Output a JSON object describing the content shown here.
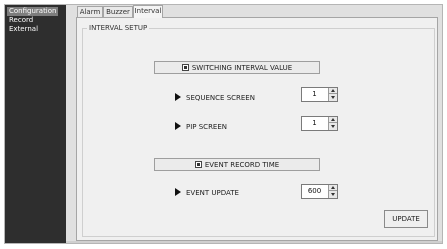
{
  "sidebar": {
    "items": [
      {
        "label": "Configuration",
        "selected": true
      },
      {
        "label": "Record",
        "selected": false
      },
      {
        "label": "External",
        "selected": false
      }
    ]
  },
  "tabs": [
    {
      "label": "Alarm",
      "active": false
    },
    {
      "label": "Buzzer",
      "active": false
    },
    {
      "label": "Interval",
      "active": true
    }
  ],
  "panel": {
    "legend": "INTERVAL SETUP",
    "switching": {
      "header": "SWITCHING INTERVAL VALUE",
      "sequence_label": "SEQUENCE  SCREEN",
      "sequence_value": "1",
      "pip_label": "PIP   SCREEN",
      "pip_value": "1"
    },
    "event": {
      "header": "EVENT RECORD TIME",
      "update_label": "EVENT UPDATE",
      "update_value": "600"
    },
    "update_button": "UPDATE"
  },
  "colors": {
    "sidebar_bg": "#2e2e2e",
    "sidebar_selected": "#7d7d7d",
    "panel_bg": "#f0f0f0"
  }
}
